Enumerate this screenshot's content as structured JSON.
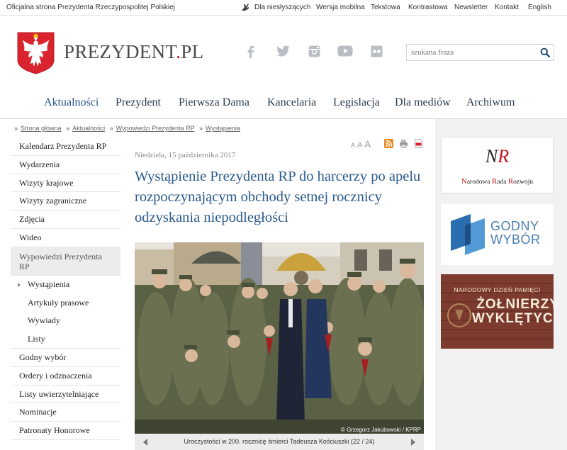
{
  "topbar": {
    "official": "Oficjalna strona Prezydenta Rzeczypospolitej Polskiej",
    "links": [
      "Dla niesłyszących",
      "Wersja mobilna",
      "Tekstowa",
      "Kontrastowa",
      "Newsletter",
      "Kontakt",
      "English"
    ]
  },
  "header": {
    "site_name_main": "PREZYDENT",
    "site_name_dot": ".",
    "site_name_tld": "PL",
    "social": [
      "facebook-icon",
      "twitter-icon",
      "instagram-icon",
      "youtube-icon",
      "flickr-icon"
    ],
    "search_placeholder": "szukana fraza"
  },
  "nav": [
    "Aktualności",
    "Prezydent",
    "Pierwsza Dama",
    "Kancelaria",
    "Legislacja",
    "Dla mediów",
    "Archiwum"
  ],
  "breadcrumb": [
    "Strona główna",
    "Aktualności",
    "Wypowiedzi Prezydenta RP",
    "Wystąpienia"
  ],
  "sidebar": {
    "items": [
      "Kalendarz Prezydenta RP",
      "Wydarzenia",
      "Wizyty krajowe",
      "Wizyty zagraniczne",
      "Zdjęcia",
      "Wideo"
    ],
    "active": "Wypowiedzi Prezydenta RP",
    "sub": [
      "Wystąpienia",
      "Artykuły prasowe",
      "Wywiady",
      "Listy"
    ],
    "more": [
      "Godny wybór",
      "Ordery i odznaczenia",
      "Listy uwierzytelniające",
      "Nominacje",
      "Patronaty Honorowe"
    ]
  },
  "article": {
    "date": "Niedziela, 15 października 2017",
    "title": "Wystąpienie Prezydenta RP do harcerzy po apelu rozpoczynającym obchody setnej rocznicy odzyskania niepodległości",
    "font_sizes": [
      "A",
      "A",
      "A"
    ],
    "photo_credit": "© Grzegorz Jakubowski / KPRP",
    "caption": "Uroczystości w 200. rocznicę śmierci Tadeusza Kościuszki (22 / 24)"
  },
  "banners": {
    "nrr_monogram_n": "N",
    "nrr_monogram_r": "R",
    "nrr_words": [
      {
        "cap": "N",
        "rest": "arodowa "
      },
      {
        "cap": "R",
        "rest": "ada "
      },
      {
        "cap": "R",
        "rest": "ozwoju"
      }
    ],
    "godny_line1": "GODNY",
    "godny_line2": "WYBÓR",
    "zw_line1": "NARODOWY DZIEŃ PAMIĘCI",
    "zw_line2": "ŻOŁNIERZY",
    "zw_line3": "WYKLĘTYCH"
  },
  "colors": {
    "accent_blue": "#2b5a8c",
    "red": "#c4151c"
  }
}
